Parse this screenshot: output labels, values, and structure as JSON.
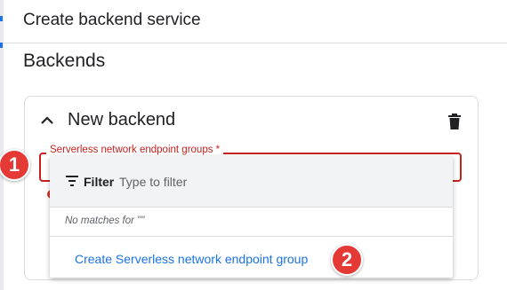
{
  "header": {
    "title": "Create backend service"
  },
  "section": {
    "title": "Backends"
  },
  "backend_card": {
    "title": "New backend",
    "field_label": "Serverless network endpoint groups *"
  },
  "dropdown": {
    "filter_label": "Filter",
    "filter_placeholder": "Type to filter",
    "no_matches": "No matches for \"\"",
    "create_link": "Create Serverless network endpoint group"
  },
  "annotations": {
    "badge_1": "1",
    "badge_2": "2"
  },
  "colors": {
    "accent": "#1a73e8",
    "error": "#c5221f",
    "badge": "#e53935"
  }
}
